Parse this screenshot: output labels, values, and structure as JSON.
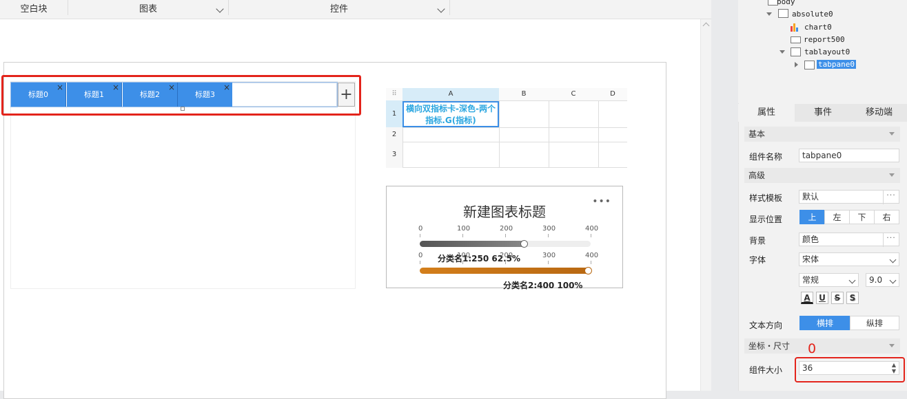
{
  "toolbar": {
    "blank_block": "空白块",
    "chart": "图表",
    "control": "控件"
  },
  "tabpane": {
    "tabs": [
      "标题0",
      "标题1",
      "标题2",
      "标题3"
    ],
    "add_button": "+",
    "close_glyph": "×"
  },
  "report": {
    "columns": [
      "A",
      "B",
      "C",
      "D"
    ],
    "rows": [
      "1",
      "2",
      "3"
    ],
    "cell_a1": "横向双指标卡-深色-两个指标.G(指标)"
  },
  "chart": {
    "menu": "•••",
    "ticks": [
      "0",
      "100",
      "200",
      "300",
      "400"
    ],
    "labels": [
      "分类名1:250 62.5%",
      "分类名2:400 100%"
    ]
  },
  "chart_data": {
    "type": "bar",
    "title": "新建图表标题",
    "categories": [
      "分类名1",
      "分类名2"
    ],
    "values": [
      250,
      400
    ],
    "percent": [
      "62.5%",
      "100%"
    ],
    "xlim": [
      0,
      400
    ],
    "orientation": "horizontal-gauge",
    "colors": [
      "#666666",
      "#d37e1b"
    ]
  },
  "tree": {
    "body": "body",
    "absolute": "absolute0",
    "chart": "chart0",
    "report": "report500",
    "tablayout": "tablayout0",
    "tabpane": "tabpane0"
  },
  "panel": {
    "tabs": {
      "attr": "属性",
      "event": "事件",
      "mobile": "移动端"
    },
    "basic": "基本",
    "name_label": "组件名称",
    "name_value": "tabpane0",
    "advanced": "高级",
    "style_label": "样式模板",
    "style_value": "默认",
    "position_label": "显示位置",
    "positions": [
      "上",
      "左",
      "下",
      "右"
    ],
    "bg_label": "背景",
    "bg_value": "颜色",
    "font_label": "字体",
    "font_value": "宋体",
    "font_style": "常规",
    "font_size": "9.0",
    "format_buttons": [
      "A",
      "U",
      "S",
      "S"
    ],
    "dir_label": "文本方向",
    "dir_options": [
      "横排",
      "纵排"
    ],
    "coord_section": "坐标・尺寸",
    "size_label": "组件大小",
    "size_value": "36",
    "annotation": "0"
  },
  "colors": {
    "accent": "#3d8fe8",
    "highlight": "#e3241b",
    "gauge2": "#d37e1b",
    "cell_text": "#2aa6e0"
  }
}
